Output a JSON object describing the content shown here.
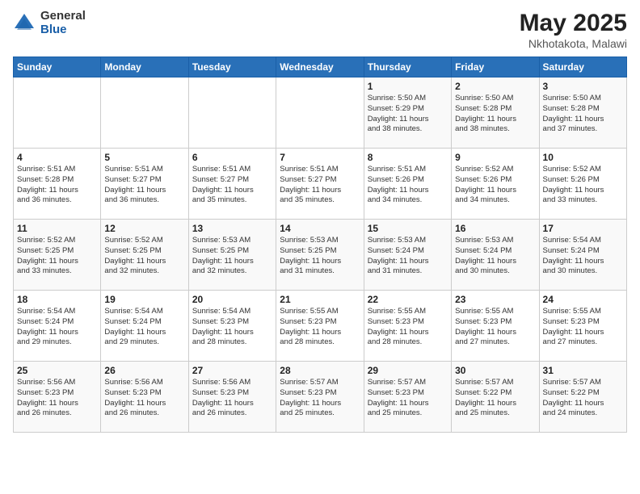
{
  "logo": {
    "general": "General",
    "blue": "Blue"
  },
  "title": "May 2025",
  "subtitle": "Nkhotakota, Malawi",
  "days_of_week": [
    "Sunday",
    "Monday",
    "Tuesday",
    "Wednesday",
    "Thursday",
    "Friday",
    "Saturday"
  ],
  "weeks": [
    [
      {
        "day": "",
        "content": ""
      },
      {
        "day": "",
        "content": ""
      },
      {
        "day": "",
        "content": ""
      },
      {
        "day": "",
        "content": ""
      },
      {
        "day": "1",
        "content": "Sunrise: 5:50 AM\nSunset: 5:29 PM\nDaylight: 11 hours\nand 38 minutes."
      },
      {
        "day": "2",
        "content": "Sunrise: 5:50 AM\nSunset: 5:28 PM\nDaylight: 11 hours\nand 38 minutes."
      },
      {
        "day": "3",
        "content": "Sunrise: 5:50 AM\nSunset: 5:28 PM\nDaylight: 11 hours\nand 37 minutes."
      }
    ],
    [
      {
        "day": "4",
        "content": "Sunrise: 5:51 AM\nSunset: 5:28 PM\nDaylight: 11 hours\nand 36 minutes."
      },
      {
        "day": "5",
        "content": "Sunrise: 5:51 AM\nSunset: 5:27 PM\nDaylight: 11 hours\nand 36 minutes."
      },
      {
        "day": "6",
        "content": "Sunrise: 5:51 AM\nSunset: 5:27 PM\nDaylight: 11 hours\nand 35 minutes."
      },
      {
        "day": "7",
        "content": "Sunrise: 5:51 AM\nSunset: 5:27 PM\nDaylight: 11 hours\nand 35 minutes."
      },
      {
        "day": "8",
        "content": "Sunrise: 5:51 AM\nSunset: 5:26 PM\nDaylight: 11 hours\nand 34 minutes."
      },
      {
        "day": "9",
        "content": "Sunrise: 5:52 AM\nSunset: 5:26 PM\nDaylight: 11 hours\nand 34 minutes."
      },
      {
        "day": "10",
        "content": "Sunrise: 5:52 AM\nSunset: 5:26 PM\nDaylight: 11 hours\nand 33 minutes."
      }
    ],
    [
      {
        "day": "11",
        "content": "Sunrise: 5:52 AM\nSunset: 5:25 PM\nDaylight: 11 hours\nand 33 minutes."
      },
      {
        "day": "12",
        "content": "Sunrise: 5:52 AM\nSunset: 5:25 PM\nDaylight: 11 hours\nand 32 minutes."
      },
      {
        "day": "13",
        "content": "Sunrise: 5:53 AM\nSunset: 5:25 PM\nDaylight: 11 hours\nand 32 minutes."
      },
      {
        "day": "14",
        "content": "Sunrise: 5:53 AM\nSunset: 5:25 PM\nDaylight: 11 hours\nand 31 minutes."
      },
      {
        "day": "15",
        "content": "Sunrise: 5:53 AM\nSunset: 5:24 PM\nDaylight: 11 hours\nand 31 minutes."
      },
      {
        "day": "16",
        "content": "Sunrise: 5:53 AM\nSunset: 5:24 PM\nDaylight: 11 hours\nand 30 minutes."
      },
      {
        "day": "17",
        "content": "Sunrise: 5:54 AM\nSunset: 5:24 PM\nDaylight: 11 hours\nand 30 minutes."
      }
    ],
    [
      {
        "day": "18",
        "content": "Sunrise: 5:54 AM\nSunset: 5:24 PM\nDaylight: 11 hours\nand 29 minutes."
      },
      {
        "day": "19",
        "content": "Sunrise: 5:54 AM\nSunset: 5:24 PM\nDaylight: 11 hours\nand 29 minutes."
      },
      {
        "day": "20",
        "content": "Sunrise: 5:54 AM\nSunset: 5:23 PM\nDaylight: 11 hours\nand 28 minutes."
      },
      {
        "day": "21",
        "content": "Sunrise: 5:55 AM\nSunset: 5:23 PM\nDaylight: 11 hours\nand 28 minutes."
      },
      {
        "day": "22",
        "content": "Sunrise: 5:55 AM\nSunset: 5:23 PM\nDaylight: 11 hours\nand 28 minutes."
      },
      {
        "day": "23",
        "content": "Sunrise: 5:55 AM\nSunset: 5:23 PM\nDaylight: 11 hours\nand 27 minutes."
      },
      {
        "day": "24",
        "content": "Sunrise: 5:55 AM\nSunset: 5:23 PM\nDaylight: 11 hours\nand 27 minutes."
      }
    ],
    [
      {
        "day": "25",
        "content": "Sunrise: 5:56 AM\nSunset: 5:23 PM\nDaylight: 11 hours\nand 26 minutes."
      },
      {
        "day": "26",
        "content": "Sunrise: 5:56 AM\nSunset: 5:23 PM\nDaylight: 11 hours\nand 26 minutes."
      },
      {
        "day": "27",
        "content": "Sunrise: 5:56 AM\nSunset: 5:23 PM\nDaylight: 11 hours\nand 26 minutes."
      },
      {
        "day": "28",
        "content": "Sunrise: 5:57 AM\nSunset: 5:23 PM\nDaylight: 11 hours\nand 25 minutes."
      },
      {
        "day": "29",
        "content": "Sunrise: 5:57 AM\nSunset: 5:23 PM\nDaylight: 11 hours\nand 25 minutes."
      },
      {
        "day": "30",
        "content": "Sunrise: 5:57 AM\nSunset: 5:22 PM\nDaylight: 11 hours\nand 25 minutes."
      },
      {
        "day": "31",
        "content": "Sunrise: 5:57 AM\nSunset: 5:22 PM\nDaylight: 11 hours\nand 24 minutes."
      }
    ]
  ]
}
